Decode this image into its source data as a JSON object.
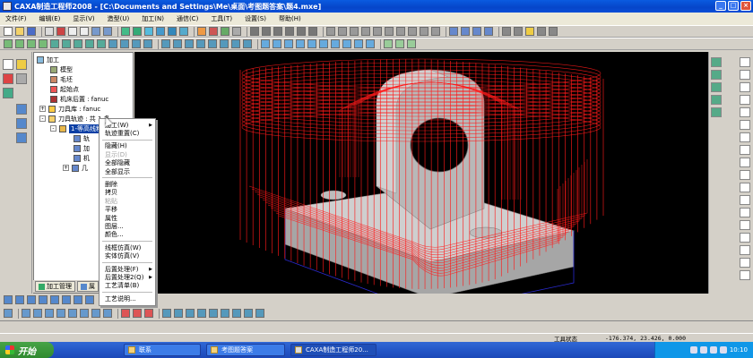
{
  "window": {
    "title": "CAXA制造工程师2008 - [C:\\Documents and Settings\\Me\\桌面\\考图题答案\\题4.mxe]"
  },
  "menu": [
    "文件(F)",
    "编辑(E)",
    "显示(V)",
    "造型(U)",
    "加工(N)",
    "通信(C)",
    "工具(T)",
    "设置(S)",
    "帮助(H)"
  ],
  "colors": {
    "titlebar": "#0a4fd8",
    "viewport_bg": "#000000",
    "toolpath": "#ff1a1a",
    "part": "#c9c9c9",
    "selection": "#0b3fa5"
  },
  "tree": {
    "root": "加工",
    "items": [
      {
        "label": "模型",
        "icon": "model-icon"
      },
      {
        "label": "毛坯",
        "icon": "blank-icon"
      },
      {
        "label": "起始点",
        "icon": "start-point-icon"
      },
      {
        "label": "机床后置 : fanuc",
        "icon": "machine-icon"
      },
      {
        "label": "刀具库 : fanuc",
        "icon": "tool-library-icon"
      },
      {
        "label": "刀具轨迹 : 共 1 条",
        "icon": "toolpath-icon"
      },
      {
        "label": "1-等高线粗加工",
        "icon": "toolpath-item-icon",
        "selected": true
      },
      {
        "label": "轨",
        "icon": "sub-icon"
      },
      {
        "label": "加",
        "icon": "sub-icon"
      },
      {
        "label": "机",
        "icon": "sub-icon"
      },
      {
        "label": "几",
        "icon": "sub-icon"
      }
    ]
  },
  "panel_tabs": [
    "加工管理",
    "属"
  ],
  "context_menu": {
    "items": [
      {
        "label": "加工(W)",
        "submenu": true
      },
      {
        "label": "轨迹重置(C)"
      },
      {
        "sep": true
      },
      {
        "label": "隐藏(H)"
      },
      {
        "label": "显示(D)",
        "disabled": true
      },
      {
        "label": "全部隐藏"
      },
      {
        "label": "全部显示"
      },
      {
        "sep": true
      },
      {
        "label": "删除"
      },
      {
        "label": "拷贝"
      },
      {
        "label": "粘贴",
        "disabled": true
      },
      {
        "label": "平移"
      },
      {
        "label": "属性"
      },
      {
        "label": "图层..."
      },
      {
        "label": "颜色..."
      },
      {
        "sep": true
      },
      {
        "label": "线框仿真(W)"
      },
      {
        "label": "实体仿真(V)"
      },
      {
        "sep": true
      },
      {
        "label": "后置处理(F)",
        "submenu": true
      },
      {
        "label": "后置处理2(Q)",
        "submenu": true
      },
      {
        "label": "工艺清单(B)"
      },
      {
        "sep": true
      },
      {
        "label": "工艺说明..."
      }
    ]
  },
  "status": {
    "label": "工具状态",
    "coords": "-176.374, 23.426, 0.000"
  },
  "taskbar": {
    "start": "开始",
    "tasks": [
      "联系",
      "考图题答案",
      "CAXA制造工程师20..."
    ],
    "time": "10:10"
  }
}
